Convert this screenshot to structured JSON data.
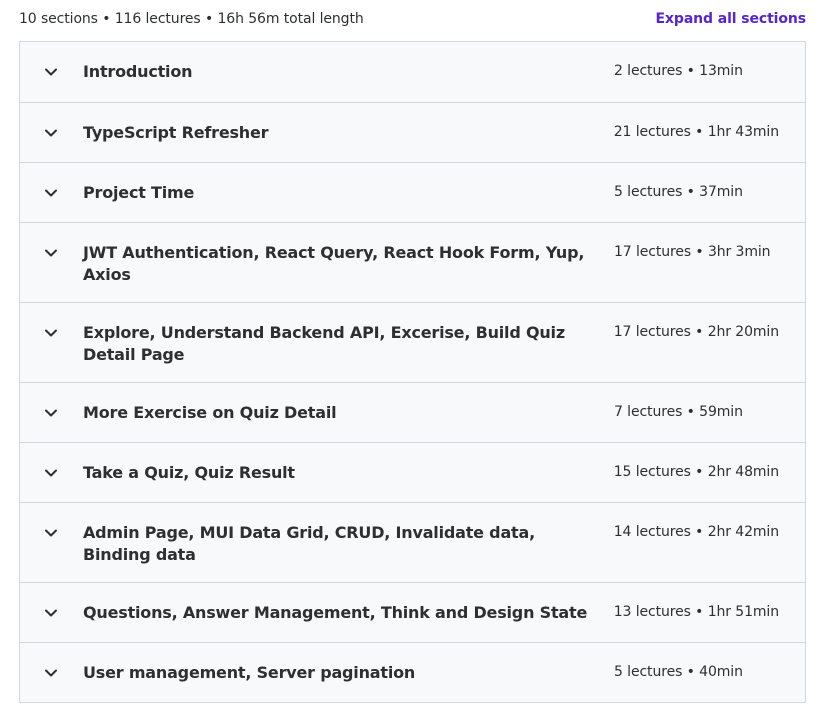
{
  "header": {
    "summary": "10 sections • 116 lectures • 16h 56m total length",
    "expand_label": "Expand all sections"
  },
  "colors": {
    "accent": "#5624d0",
    "text": "#2d2f31",
    "border": "#d1d7dc",
    "row_bg": "#f7f9fa"
  },
  "sections": [
    {
      "title": "Introduction",
      "meta": "2 lectures • 13min",
      "icon": "chevron-down-icon"
    },
    {
      "title": "TypeScript Refresher",
      "meta": "21 lectures • 1hr 43min",
      "icon": "chevron-down-icon"
    },
    {
      "title": "Project Time",
      "meta": "5 lectures • 37min",
      "icon": "chevron-down-icon"
    },
    {
      "title": "JWT Authentication, React Query, React Hook Form, Yup, Axios",
      "meta": "17 lectures • 3hr 3min",
      "icon": "chevron-down-icon"
    },
    {
      "title": "Explore, Understand Backend API, Excerise, Build Quiz Detail Page",
      "meta": "17 lectures • 2hr 20min",
      "icon": "chevron-down-icon"
    },
    {
      "title": "More Exercise on Quiz Detail",
      "meta": "7 lectures • 59min",
      "icon": "chevron-down-icon"
    },
    {
      "title": "Take a Quiz, Quiz Result",
      "meta": "15 lectures • 2hr 48min",
      "icon": "chevron-down-icon"
    },
    {
      "title": "Admin Page, MUI Data Grid, CRUD, Invalidate data, Binding data",
      "meta": "14 lectures • 2hr 42min",
      "icon": "chevron-down-icon"
    },
    {
      "title": "Questions, Answer Management, Think and Design State",
      "meta": "13 lectures • 1hr 51min",
      "icon": "chevron-down-icon"
    },
    {
      "title": "User management, Server pagination",
      "meta": "5 lectures • 40min",
      "icon": "chevron-down-icon"
    }
  ]
}
